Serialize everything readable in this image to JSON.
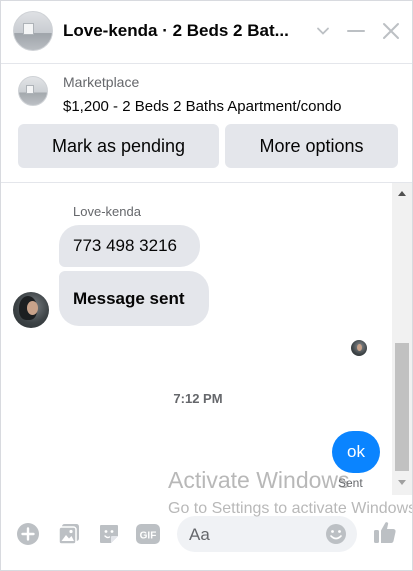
{
  "header": {
    "title": "Love-kenda · 2 Beds 2 Bat..."
  },
  "marketplace": {
    "label": "Marketplace",
    "listing": "$1,200 - 2 Beds 2 Baths Apartment/condo",
    "buttons": {
      "mark_pending": "Mark as pending",
      "more_options": "More options"
    }
  },
  "conversation": {
    "sender_name": "Love-kenda",
    "incoming": [
      "773 498 3216",
      "Message sent"
    ],
    "timestamp": "7:12 PM",
    "outgoing": "ok",
    "status": "Sent"
  },
  "watermark": {
    "title": "Activate Windows",
    "subtitle": "Go to Settings to activate Windows."
  },
  "composer": {
    "placeholder": "Aa"
  },
  "colors": {
    "accent": "#0a84ff",
    "bubble_gray": "#e4e6eb",
    "icon_gray": "#bcc0c4",
    "muted_text": "#65676b"
  },
  "icons": {
    "header": [
      "chevron-down-icon",
      "minimize-icon",
      "close-icon"
    ],
    "composer": [
      "plus-circle-icon",
      "photo-icon",
      "sticker-icon",
      "gif-icon",
      "emoji-icon",
      "thumbs-up-icon"
    ]
  }
}
